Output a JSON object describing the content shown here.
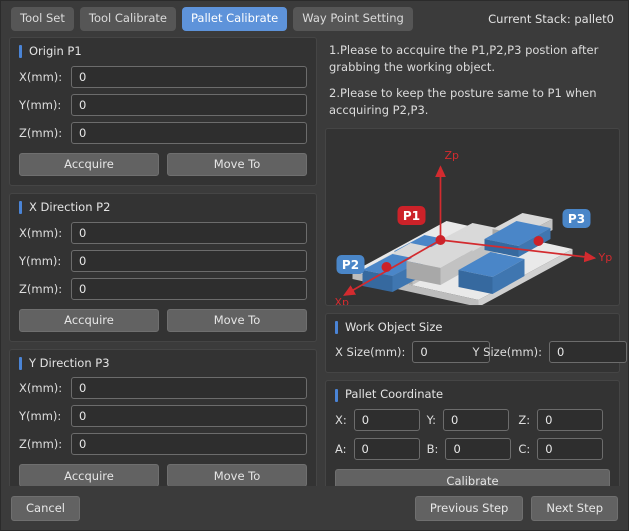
{
  "header": {
    "tabs": [
      {
        "label": "Tool Set",
        "active": false
      },
      {
        "label": "Tool Calibrate",
        "active": false
      },
      {
        "label": "Pallet Calibrate",
        "active": true
      },
      {
        "label": "Way Point Setting",
        "active": false
      }
    ],
    "current_stack": "Current Stack: pallet0"
  },
  "colors": {
    "accent_blue": "#4a84d6",
    "tab_active": "#5e93da",
    "panel_bg": "#333333",
    "window_bg": "#3b3b3b",
    "input_bg": "#2e2e2e",
    "button_bg": "#626262",
    "point_red": "#cc2229",
    "box_blue": "#4a86c8",
    "box_gray": "#d5d5d5"
  },
  "left": {
    "groups": [
      {
        "title": "Origin P1",
        "fields": [
          {
            "label": "X(mm):",
            "value": "0"
          },
          {
            "label": "Y(mm):",
            "value": "0"
          },
          {
            "label": "Z(mm):",
            "value": "0"
          }
        ],
        "acquire_label": "Accquire",
        "move_label": "Move To"
      },
      {
        "title": "X Direction P2",
        "fields": [
          {
            "label": "X(mm):",
            "value": "0"
          },
          {
            "label": "Y(mm):",
            "value": "0"
          },
          {
            "label": "Z(mm):",
            "value": "0"
          }
        ],
        "acquire_label": "Accquire",
        "move_label": "Move To"
      },
      {
        "title": "Y Direction P3",
        "fields": [
          {
            "label": "X(mm):",
            "value": "0"
          },
          {
            "label": "Y(mm):",
            "value": "0"
          },
          {
            "label": "Z(mm):",
            "value": "0"
          }
        ],
        "acquire_label": "Accquire",
        "move_label": "Move To"
      }
    ]
  },
  "right": {
    "instruction_1": "1.Please to accquire the P1,P2,P3 postion after grabbing the working object.",
    "instruction_2": "2.Please to keep the posture same to P1 when accquiring P2,P3.",
    "illustration": {
      "axis_x_label": "Xp",
      "axis_y_label": "Yp",
      "axis_z_label": "Zp",
      "point_labels": [
        "P1",
        "P2",
        "P3"
      ]
    },
    "work_object_size": {
      "title": "Work Object Size",
      "x_label": "X Size(mm):",
      "x_value": "0",
      "y_label": "Y Size(mm):",
      "y_value": "0"
    },
    "pallet_coordinate": {
      "title": "Pallet Coordinate",
      "x_label": "X:",
      "x_value": "0",
      "y_label": "Y:",
      "y_value": "0",
      "z_label": "Z:",
      "z_value": "0",
      "a_label": "A:",
      "a_value": "0",
      "b_label": "B:",
      "b_value": "0",
      "c_label": "C:",
      "c_value": "0",
      "calibrate_label": "Calibrate"
    }
  },
  "footer": {
    "cancel_label": "Cancel",
    "previous_label": "Previous Step",
    "next_label": "Next Step"
  }
}
